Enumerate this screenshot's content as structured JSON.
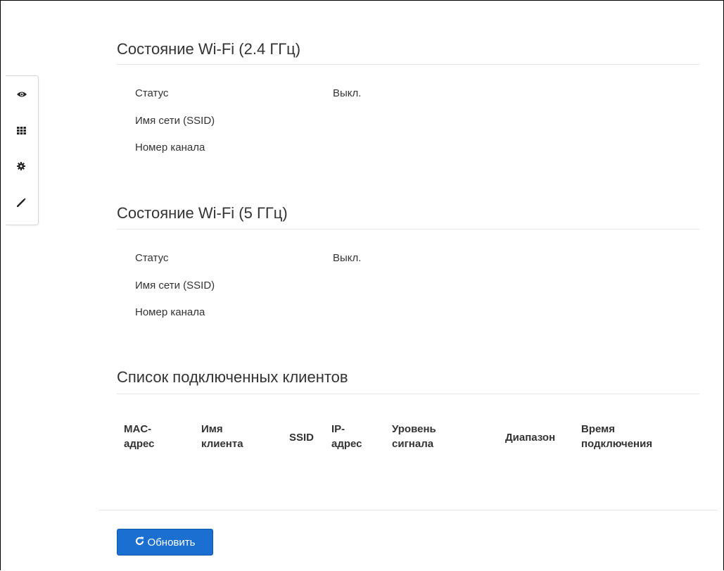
{
  "wifi24": {
    "title": "Состояние Wi-Fi (2.4 ГГц)",
    "rows": [
      {
        "label": "Статус",
        "value": "Выкл."
      },
      {
        "label": "Имя сети (SSID)",
        "value": ""
      },
      {
        "label": "Номер канала",
        "value": ""
      }
    ]
  },
  "wifi5": {
    "title": "Состояние Wi-Fi (5 ГГц)",
    "rows": [
      {
        "label": "Статус",
        "value": "Выкл."
      },
      {
        "label": "Имя сети (SSID)",
        "value": ""
      },
      {
        "label": "Номер канала",
        "value": ""
      }
    ]
  },
  "clients": {
    "title": "Список подключенных клиентов",
    "columns": [
      {
        "line1": "MAC-",
        "line2": "адрес"
      },
      {
        "line1": "Имя",
        "line2": "клиента"
      },
      {
        "line1": "SSID",
        "line2": ""
      },
      {
        "line1": "IP-",
        "line2": "адрес"
      },
      {
        "line1": "Уровень",
        "line2": "сигнала"
      },
      {
        "line1": "Диапазон",
        "line2": ""
      },
      {
        "line1": "Время",
        "line2": "подключения"
      }
    ]
  },
  "sidebar": {
    "items": [
      {
        "icon": "eye-icon"
      },
      {
        "icon": "grid-icon"
      },
      {
        "icon": "gear-icon"
      },
      {
        "icon": "magic-wand-icon"
      }
    ]
  },
  "footer": {
    "refresh_label": "Обновить",
    "refresh_icon": "refresh-icon"
  },
  "colors": {
    "accent": "#1a6fd1",
    "text": "#333333",
    "divider": "#e5e5e5"
  }
}
